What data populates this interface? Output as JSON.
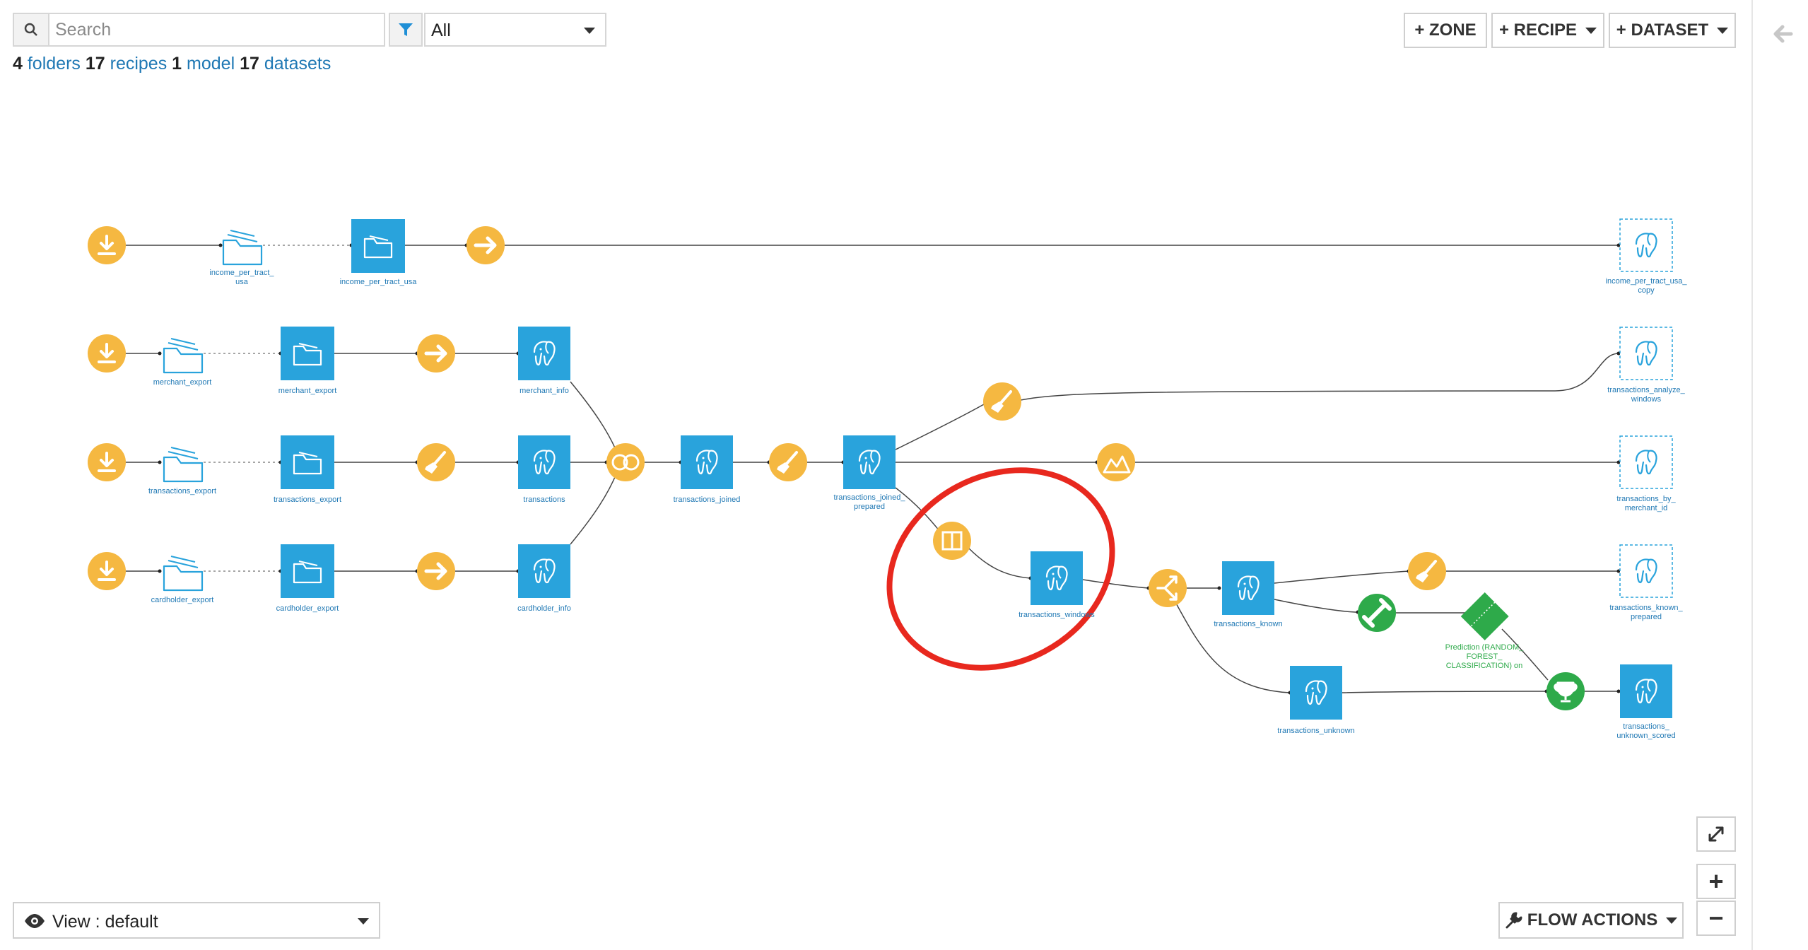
{
  "toolbar": {
    "search_placeholder": "Search",
    "filter_value": "All",
    "zone_label": "+ ZONE",
    "recipe_label": "+ RECIPE",
    "dataset_label": "+ DATASET"
  },
  "summary": {
    "folders_count": "4",
    "folders_label": "folders",
    "recipes_count": "17",
    "recipes_label": "recipes",
    "models_count": "1",
    "models_label": "model",
    "datasets_count": "17",
    "datasets_label": "datasets"
  },
  "colors": {
    "dataset_blue": "#29a3dc",
    "recipe_orange": "#f5b841",
    "model_green": "#2eaa4a",
    "link_blue": "#1f78b4",
    "highlight_red": "#e8281e"
  },
  "flow": {
    "folders": [
      {
        "name": "income-per-tract-usa-folder",
        "label": "income_per_tract_\nusa"
      },
      {
        "name": "merchant-export-folder",
        "label": "merchant_export"
      },
      {
        "name": "transactions-export-folder",
        "label": "transactions_export"
      },
      {
        "name": "cardholder-export-folder",
        "label": "cardholder_export"
      }
    ],
    "managed_folders": [
      {
        "label": "income_per_tract_usa"
      },
      {
        "label": "merchant_export"
      },
      {
        "label": "transactions_export"
      },
      {
        "label": "cardholder_export"
      }
    ],
    "datasets": {
      "merchant_info": "merchant_info",
      "transactions": "transactions",
      "cardholder_info": "cardholder_info",
      "transactions_joined": "transactions_joined",
      "transactions_joined_prepared": "transactions_joined_\nprepared",
      "transactions_windows": "transactions_windows",
      "transactions_known": "transactions_known",
      "transactions_unknown": "transactions_unknown",
      "income_per_tract_usa_copy": "income_per_tract_usa_\ncopy",
      "transactions_analyze_windows": "transactions_analyze_\nwindows",
      "transactions_by_merchant_id": "transactions_by_\nmerchant_id",
      "transactions_known_prepared": "transactions_known_\nprepared",
      "transactions_unknown_scored": "transactions_\nunknown_scored"
    },
    "model_label": "Prediction (RANDOM_\nFOREST_\nCLASSIFICATION) on"
  },
  "bottom": {
    "view_label": "View : default",
    "flow_actions_label": "FLOW ACTIONS",
    "zoom_in": "+",
    "zoom_out": "−"
  }
}
